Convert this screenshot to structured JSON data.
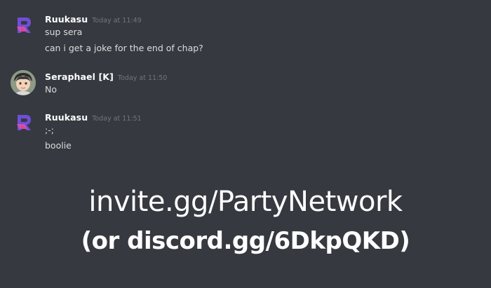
{
  "messages": [
    {
      "username": "Ruukasu",
      "timestamp": "Today at 11:49",
      "avatar_icon": "r-logo-icon",
      "lines": [
        "sup sera",
        "can i get a joke for the end of chap?"
      ]
    },
    {
      "username": "Seraphael [K]",
      "timestamp": "Today at 11:50",
      "avatar_icon": "anime-character-avatar",
      "lines": [
        "No"
      ]
    },
    {
      "username": "Ruukasu",
      "timestamp": "Today at 11:51",
      "avatar_icon": "r-logo-icon",
      "lines": [
        ";-;",
        "boolie"
      ]
    }
  ],
  "banner": {
    "line1": "invite.gg/PartyNetwork",
    "line2": "(or discord.gg/6DkpQKD)"
  },
  "colors": {
    "background": "#36393f",
    "username": "#ffffff",
    "message_text": "#dcddde",
    "timestamp": "#72767d",
    "logo_purple": "#6f4ed8",
    "logo_pink": "#e94fa8"
  }
}
